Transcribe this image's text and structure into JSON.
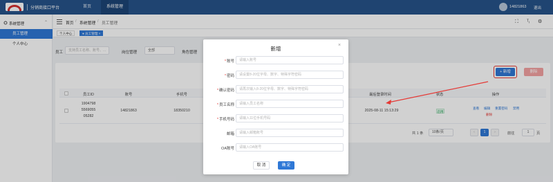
{
  "topbar": {
    "app_title": "分销商接口平台",
    "nav": [
      "首页",
      "系统管理"
    ],
    "user": "14821863",
    "logout": "退出"
  },
  "sidebar": {
    "group": "系统管理",
    "items": [
      "员工管理",
      "个人中心"
    ]
  },
  "breadcrumb": [
    "首页",
    "系统管理",
    "员工管理"
  ],
  "tags": [
    "个人中心",
    "● 员工管理 ×"
  ],
  "filters": {
    "employee_label": "员工",
    "employee_placeholder": "支持员工名称、账号、...",
    "position_label": "岗位管理",
    "position_value": "全部",
    "role_label": "角色管理"
  },
  "toolbar": {
    "add_label": "+ 新增",
    "delete_label": "删除"
  },
  "table": {
    "headers": [
      "员工ID",
      "账号",
      "手机号",
      "最后登录时间",
      "状态",
      "操作"
    ],
    "rows": [
      {
        "id_lines": [
          "1904798",
          "5569055",
          "05282"
        ],
        "account": "14821863",
        "phone": "18350210",
        "last_login": "2025-08-11 15:13:29",
        "status": "启用",
        "ops": [
          "查看",
          "编辑",
          "重置密码",
          "禁用",
          "删除"
        ]
      }
    ]
  },
  "pager": {
    "total": "共 1 条",
    "size": "10条/页",
    "page": "1",
    "goto_label": "前往",
    "goto_value": "1",
    "page_suffix": "页"
  },
  "modal": {
    "title": "新增",
    "close": "×",
    "fields": [
      {
        "label": "账号",
        "required": true,
        "placeholder": "请输入账号"
      },
      {
        "label": "密码",
        "required": true,
        "placeholder": "请设置8-20位字母、数字、特殊字符密码"
      },
      {
        "label": "确认密码",
        "required": true,
        "placeholder": "请再次输入8-20位字母、数字、特殊字符密码"
      },
      {
        "label": "员工名称",
        "required": true,
        "placeholder": "请输入员工名称"
      },
      {
        "label": "手机号码",
        "required": true,
        "placeholder": "请输入11位手机号码"
      },
      {
        "label": "邮箱",
        "required": false,
        "placeholder": "请输入邮箱账号"
      },
      {
        "label": "OA账号",
        "required": false,
        "placeholder": "请输入OA账号"
      }
    ],
    "cancel": "取 消",
    "confirm": "确 定"
  },
  "colors": {
    "brand": "#27548a",
    "accent": "#2f78d6",
    "highlight": "#e53935"
  }
}
